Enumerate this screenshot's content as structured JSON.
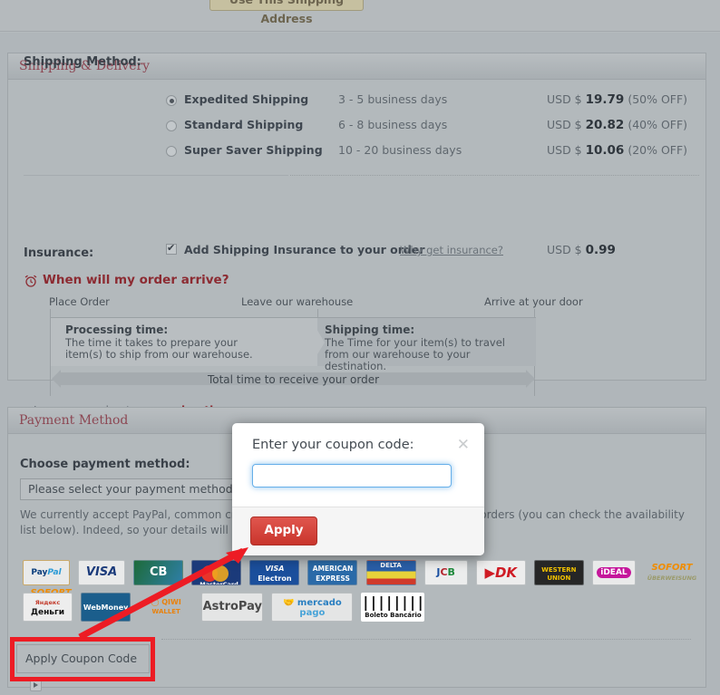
{
  "top": {
    "use_shipping_address_label": "Use This Shipping Address"
  },
  "shipping": {
    "section_title": "Shipping & Delivery",
    "method_label": "Shipping Method:",
    "methods": [
      {
        "name": "Expedited Shipping",
        "days": "3 - 5 business days",
        "currency": "USD $",
        "price": "19.79",
        "discount": "(50% OFF)",
        "selected": true
      },
      {
        "name": "Standard Shipping",
        "days": "6 - 8 business days",
        "currency": "USD $",
        "price": "20.82",
        "discount": "(40% OFF)",
        "selected": false
      },
      {
        "name": "Super Saver Shipping",
        "days": "10 - 20 business days",
        "currency": "USD $",
        "price": "10.06",
        "discount": "(20% OFF)",
        "selected": false
      }
    ],
    "insurance": {
      "label": "Insurance:",
      "checkbox_label": "Add Shipping Insurance to your order",
      "why_link": "Why get insurance?",
      "checked": true,
      "currency": "USD $",
      "price": "0.99"
    },
    "arrival": {
      "heading": "When will my order arrive?",
      "icon": "alarm-clock-icon",
      "captions": [
        "Place Order",
        "Leave our warehouse",
        "Arrive at your door"
      ],
      "stages": [
        {
          "title": "Processing time:",
          "desc": "The time it takes to prepare your item(s) to ship from our warehouse."
        },
        {
          "title": "Shipping time:",
          "desc": "The Time for your item(s) to travel from our warehouse to your destination."
        }
      ],
      "total_label": "Total time to receive your order"
    },
    "learn_more_prefix": "Learn more about ",
    "learn_more_link": "processing time"
  },
  "payment": {
    "section_title": "Payment Method",
    "choose_label": "Choose payment method:",
    "select_value": "Please select your payment method",
    "note": "We currently accept PayPal, common credit cards, and realtime bank transfer for all orders (you can check the availability list below). Indeed, so your details will be safe with us.",
    "logos_row_1": [
      "PayPal",
      "VISA",
      "CB",
      "MasterCard",
      "VISA Electron",
      "AMERICAN EXPRESS",
      "DELTA",
      "JCB",
      "DK",
      "WESTERN UNION",
      "iDEAL",
      "SOFORT ÜBERWEISUNG",
      "SOFORT BANKING"
    ],
    "logos_row_2": [
      "Яндекс Деньги",
      "WebMoney",
      "QIWI WALLET",
      "AstroPay",
      "mercado pago",
      "Boleto Bancário"
    ],
    "apply_coupon_button": "Apply Coupon Code"
  },
  "modal": {
    "title": "Enter your coupon code:",
    "close_icon": "close-icon",
    "input_value": "",
    "input_placeholder": "",
    "apply_label": "Apply"
  },
  "colors": {
    "accent_red": "#ed1c24",
    "header_text": "#8c4753",
    "page_bg": "#b0b6ba",
    "apply_button": "#c9352c",
    "focus_blue": "#66afe9"
  }
}
